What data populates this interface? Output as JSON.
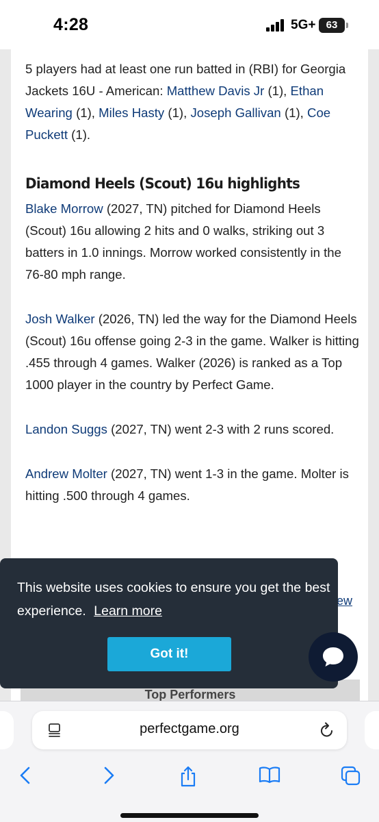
{
  "status_bar": {
    "time": "4:28",
    "network": "5G+",
    "battery": "63",
    "icons": [
      "signal-bars-icon",
      "battery-icon"
    ]
  },
  "article": {
    "rbi_paragraph": {
      "intro": "5 players had at least one run batted in (RBI) for Georgia Jackets 16U - American: ",
      "players": [
        {
          "name": "Matthew Davis Jr",
          "suffix": " (1), "
        },
        {
          "name": "Ethan Wearing",
          "suffix": " (1), "
        },
        {
          "name": "Miles Hasty",
          "suffix": " (1), "
        },
        {
          "name": "Joseph Gallivan",
          "suffix": " (1), "
        },
        {
          "name": "Coe Puckett",
          "suffix": " (1)."
        }
      ]
    },
    "section_heading": "Diamond Heels (Scout) 16u highlights",
    "highlights": [
      {
        "player": "Blake Morrow",
        "text": " (2027, TN) pitched for Diamond Heels (Scout) 16u allowing 2 hits and 0 walks, striking out 3 batters in 1.0 innings. Morrow worked consistently in the 76-80 mph range."
      },
      {
        "player": "Josh Walker",
        "text": " (2026, TN) led the way for the Diamond Heels (Scout) 16u offense going 2-3 in the game. Walker is hitting .455 through 4 games. Walker (2026) is ranked as a Top 1000 player in the country by Perfect Game."
      },
      {
        "player": "Landon Suggs",
        "text": " (2027, TN) went 2-3 with 2 runs scored."
      },
      {
        "player": "Andrew Molter",
        "text": " (2027, TN) went 1-3 in the game. Molter is hitting .500 through 4 games."
      }
    ],
    "view_link_fragment": "ew",
    "top_performers_heading": "Top Performers"
  },
  "cookie_banner": {
    "message": "This website uses cookies to ensure you get the best experience.",
    "learn_more": "Learn more",
    "button_label": "Got it!",
    "colors": {
      "background": "#252e39",
      "button": "#1ba8d8"
    }
  },
  "chat": {
    "icon": "chat-bubble-icon"
  },
  "browser": {
    "url": "perfectgame.org",
    "toolbar_icons": [
      "back-icon",
      "forward-icon",
      "share-icon",
      "bookmarks-icon",
      "tabs-icon"
    ],
    "accent_color": "#1a7cf5"
  }
}
